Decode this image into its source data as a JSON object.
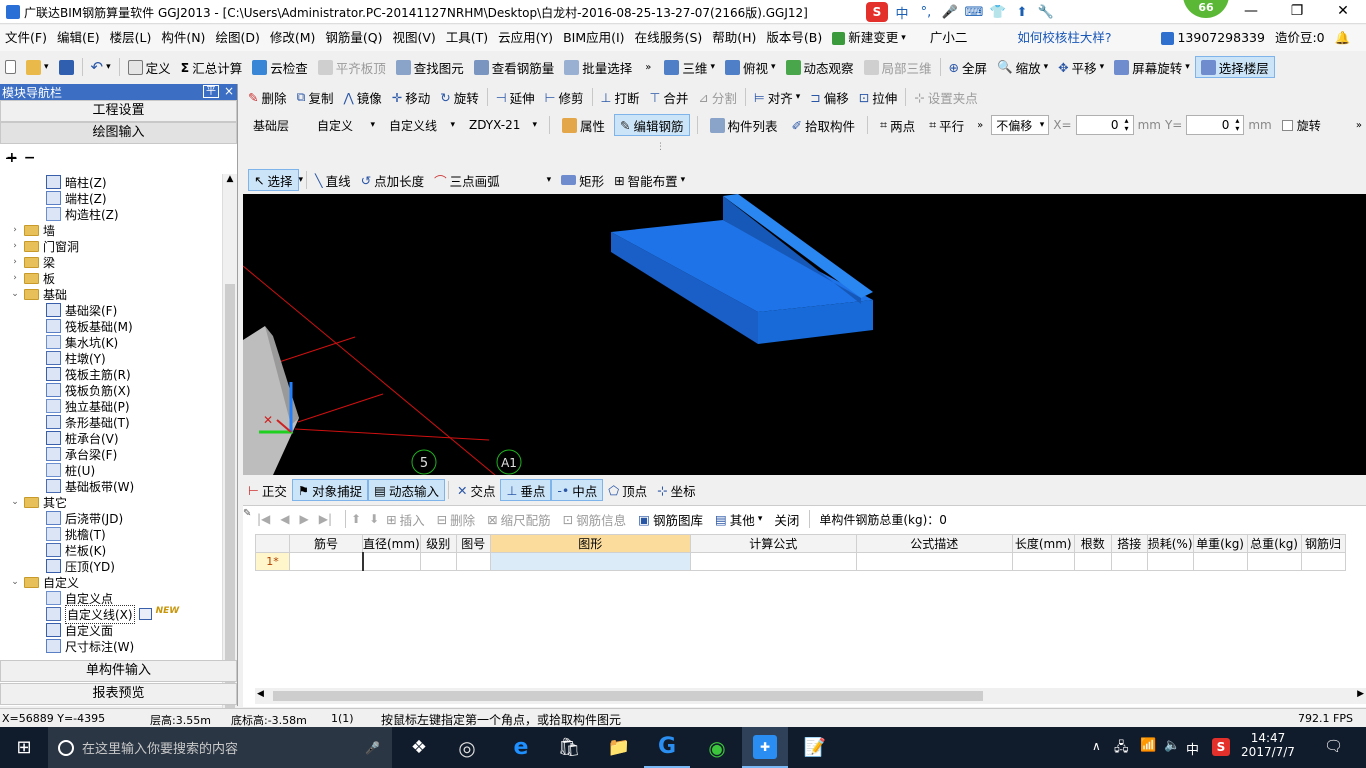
{
  "window": {
    "title": "广联达BIM钢筋算量软件 GGJ2013 - [C:\\Users\\Administrator.PC-20141127NRHM\\Desktop\\白龙村-2016-08-25-13-27-07(2166版).GGJ12]",
    "badge": "66",
    "ime": [
      "中",
      "°,",
      "🎤",
      "⌨",
      "👕",
      "⬆",
      "🔧"
    ]
  },
  "menu": {
    "items": [
      "文件(F)",
      "编辑(E)",
      "楼层(L)",
      "构件(N)",
      "绘图(D)",
      "修改(M)",
      "钢筋量(Q)",
      "视图(V)",
      "工具(T)",
      "云应用(Y)",
      "BIM应用(I)",
      "在线服务(S)",
      "帮助(H)",
      "版本号(B)"
    ],
    "new_change": "新建变更",
    "user_name": "广小二",
    "help_link": "如何校核柱大样?",
    "phone": "13907298339",
    "cost_bean": "造价豆:0"
  },
  "toolbar1": {
    "items": [
      "定义",
      "汇总计算",
      "云检查",
      "平齐板顶",
      "查找图元",
      "查看钢筋量",
      "批量选择"
    ],
    "view3d": "三维",
    "top_view": "俯视",
    "dynamic_obs": "动态观察",
    "local3d": "局部三维",
    "fullscreen": "全屏",
    "zoom": "缩放",
    "pan": "平移",
    "rotate": "屏幕旋转",
    "select_floor": "选择楼层"
  },
  "toolbar2": {
    "items": [
      "删除",
      "复制",
      "镜像",
      "移动",
      "旋转",
      "延伸",
      "修剪",
      "打断",
      "合并",
      "分割",
      "对齐",
      "偏移",
      "拉伸",
      "设置夹点"
    ]
  },
  "toolbar3": {
    "layer": "基础层",
    "category": "自定义",
    "type": "自定义线",
    "name": "ZDYX-21",
    "attr": "属性",
    "edit_rebar": "编辑钢筋",
    "comp_list": "构件列表",
    "pick": "拾取构件",
    "two_points": "两点",
    "parallel": "平行",
    "offset_mode": "不偏移",
    "x_label": "X=",
    "x_value": "0",
    "y_label": "Y=",
    "y_value": "0",
    "unit": "mm",
    "rotate": "旋转"
  },
  "toolbar4": {
    "select": "选择",
    "line": "直线",
    "point_len": "点加长度",
    "arc": "三点画弧",
    "rect": "矩形",
    "smart": "智能布置"
  },
  "left_panel": {
    "title": "模块导航栏",
    "pin": "平",
    "close": "×",
    "btn_project": "工程设置",
    "btn_draw": "绘图输入",
    "btn_single": "单构件输入",
    "btn_report": "报表预览",
    "tree": [
      {
        "label": "暗柱(Z)",
        "level": 2
      },
      {
        "label": "端柱(Z)",
        "level": 2
      },
      {
        "label": "构造柱(Z)",
        "level": 2
      },
      {
        "label": "墙",
        "level": 1,
        "folder": true,
        "expand": "+"
      },
      {
        "label": "门窗洞",
        "level": 1,
        "folder": true,
        "expand": "+"
      },
      {
        "label": "梁",
        "level": 1,
        "folder": true,
        "expand": "+"
      },
      {
        "label": "板",
        "level": 1,
        "folder": true,
        "expand": "+"
      },
      {
        "label": "基础",
        "level": 1,
        "folder": true,
        "expand": "-"
      },
      {
        "label": "基础梁(F)",
        "level": 2
      },
      {
        "label": "筏板基础(M)",
        "level": 2
      },
      {
        "label": "集水坑(K)",
        "level": 2
      },
      {
        "label": "柱墩(Y)",
        "level": 2
      },
      {
        "label": "筏板主筋(R)",
        "level": 2
      },
      {
        "label": "筏板负筋(X)",
        "level": 2
      },
      {
        "label": "独立基础(P)",
        "level": 2
      },
      {
        "label": "条形基础(T)",
        "level": 2
      },
      {
        "label": "桩承台(V)",
        "level": 2
      },
      {
        "label": "承台梁(F)",
        "level": 2
      },
      {
        "label": "桩(U)",
        "level": 2
      },
      {
        "label": "基础板带(W)",
        "level": 2
      },
      {
        "label": "其它",
        "level": 1,
        "folder": true,
        "expand": "-"
      },
      {
        "label": "后浇带(JD)",
        "level": 2
      },
      {
        "label": "挑檐(T)",
        "level": 2
      },
      {
        "label": "栏板(K)",
        "level": 2
      },
      {
        "label": "压顶(YD)",
        "level": 2
      },
      {
        "label": "自定义",
        "level": 1,
        "folder": true,
        "expand": "-"
      },
      {
        "label": "自定义点",
        "level": 2
      },
      {
        "label": "自定义线(X)",
        "level": 2,
        "selected": true,
        "new": "NEW"
      },
      {
        "label": "自定义面",
        "level": 2
      },
      {
        "label": "尺寸标注(W)",
        "level": 2
      }
    ]
  },
  "viewport": {
    "axis_labels": [
      "5",
      "A1"
    ]
  },
  "snap_bar": {
    "items": [
      "正交",
      "对象捕捉",
      "动态输入",
      "交点",
      "垂点",
      "中点",
      "顶点",
      "坐标"
    ]
  },
  "rebar_grid": {
    "toolbar": [
      "插入",
      "删除",
      "缩尺配筋",
      "钢筋信息",
      "钢筋图库",
      "其他",
      "关闭"
    ],
    "total_weight_label": "单构件钢筋总重(kg)：0",
    "columns": [
      "筋号",
      "直径(mm)",
      "级别",
      "图号",
      "图形",
      "计算公式",
      "公式描述",
      "长度(mm)",
      "根数",
      "搭接",
      "损耗(%)",
      "单重(kg)",
      "总重(kg)",
      "钢筋归"
    ],
    "rows": [
      {
        "index": "1*"
      }
    ]
  },
  "status": {
    "coords": "X=56889 Y=-4395",
    "floor_height": "层高:3.55m",
    "base_height": "底标高:-3.58m",
    "count": "1(1)",
    "hint": "按鼠标左键指定第一个角点，或拾取构件图元",
    "fps": "792.1 FPS"
  },
  "taskbar": {
    "search_placeholder": "在这里输入你要搜索的内容",
    "time": "14:47",
    "date": "2017/7/7",
    "lang": "中"
  }
}
